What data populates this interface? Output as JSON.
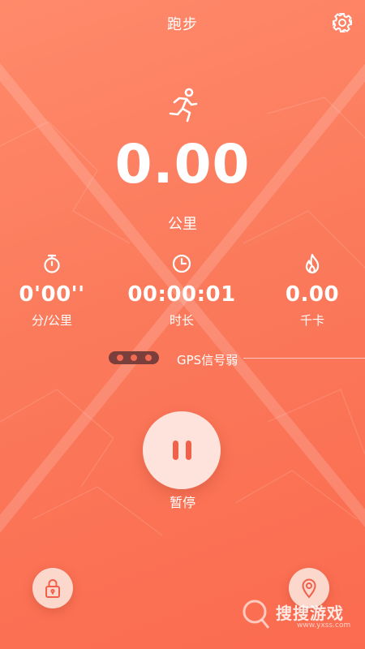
{
  "header": {
    "title": "跑步"
  },
  "icons": {
    "settings": "gear-icon",
    "activity": "running-icon",
    "pace": "stopwatch-icon",
    "duration": "clock-icon",
    "calories": "flame-icon",
    "lock": "lock-icon",
    "location": "location-pin-icon",
    "watermark": "magnifier-logo"
  },
  "distance": {
    "value": "0.00",
    "unit": "公里"
  },
  "stats": [
    {
      "value": "0'00''",
      "label": "分/公里"
    },
    {
      "value": "00:00:01",
      "label": "时长"
    },
    {
      "value": "0.00",
      "label": "千卡"
    }
  ],
  "gps": {
    "text": "GPS信号弱"
  },
  "controls": {
    "pause_label": "暂停"
  },
  "watermark": {
    "text": "搜搜游戏",
    "subtext": "www.yxss.com"
  },
  "colors": {
    "background": "#fb7a5c",
    "pause_button_fill": "#fde3dc",
    "pause_bars": "#f2604a",
    "gps_indicator": "#7a3e3b"
  }
}
